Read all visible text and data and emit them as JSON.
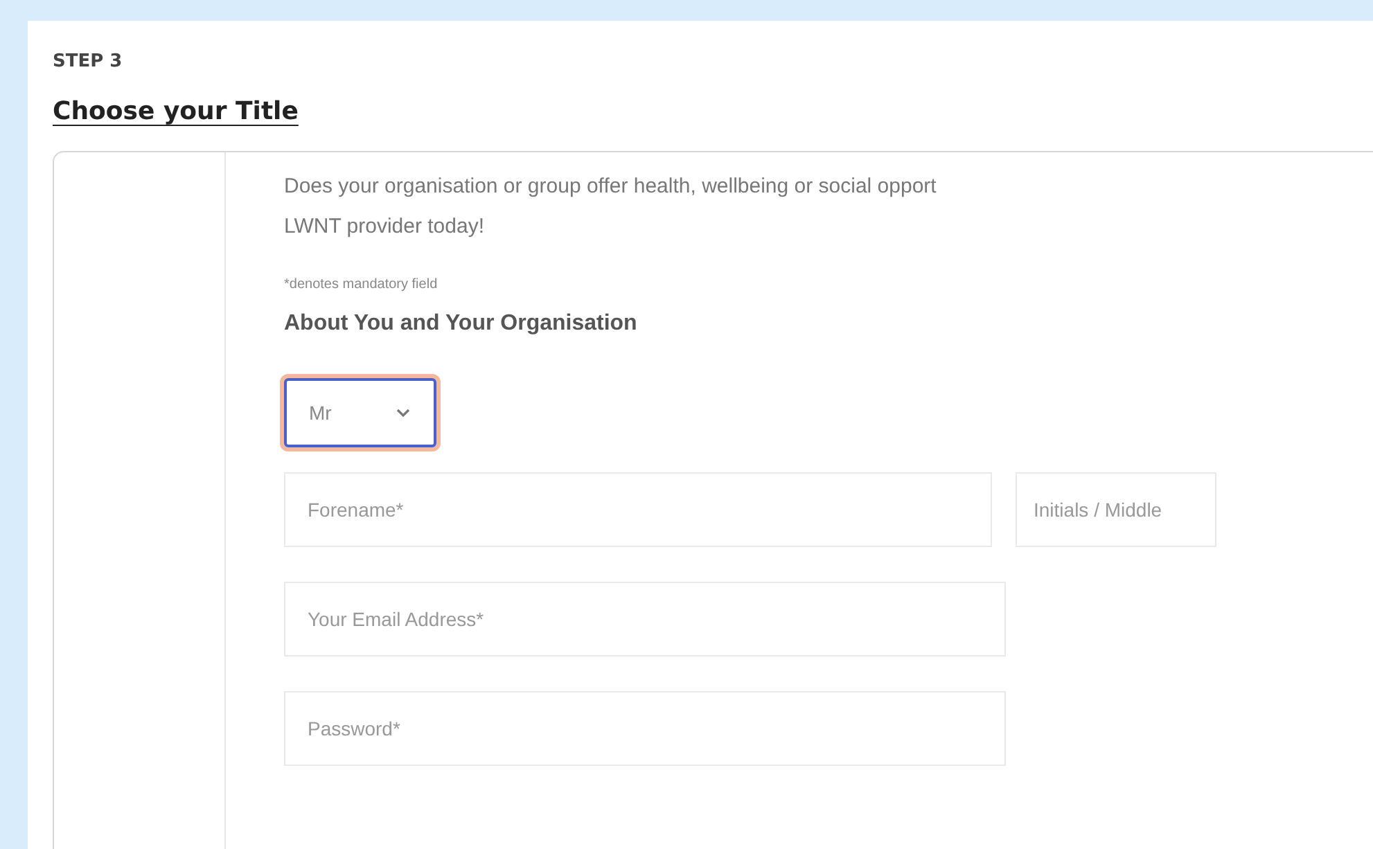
{
  "step": "STEP 3",
  "heading": "Choose your Title",
  "intro_lines": [
    "Does your organisation or group offer health, wellbeing or social opport",
    "LWNT provider today!"
  ],
  "mandatory_note": "*denotes mandatory field",
  "section_title": "About You and Your Organisation",
  "title_select": {
    "value": "Mr",
    "focused": true
  },
  "name_fields": [
    {
      "placeholder": "Forename*"
    },
    {
      "placeholder": "Initials / Middle"
    }
  ],
  "fields": [
    {
      "placeholder": "Your Email Address*"
    },
    {
      "placeholder": "Password*"
    }
  ]
}
